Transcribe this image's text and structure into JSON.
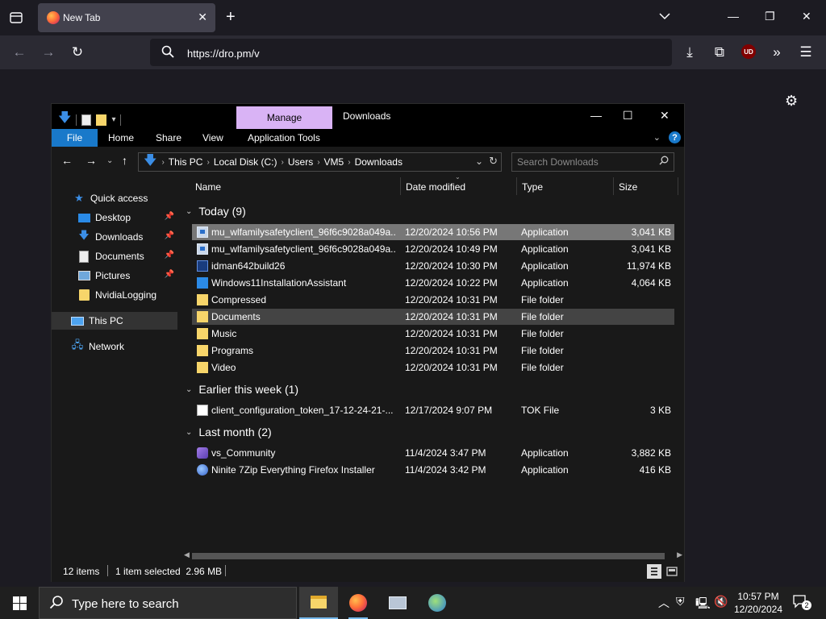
{
  "browser": {
    "tab_title": "New Tab",
    "url": "https://dro.pm/v",
    "ublock_label": "UD"
  },
  "explorer": {
    "title": "Downloads",
    "contextual_tab": "Manage",
    "ribbon_tabs": [
      "File",
      "Home",
      "Share",
      "View",
      "Application Tools"
    ],
    "breadcrumbs": [
      "This PC",
      "Local Disk (C:)",
      "Users",
      "VM5",
      "Downloads"
    ],
    "search_placeholder": "Search Downloads",
    "nav": {
      "quick_access": "Quick access",
      "desktop": "Desktop",
      "downloads": "Downloads",
      "documents": "Documents",
      "pictures": "Pictures",
      "nvidia": "NvidiaLogging",
      "this_pc": "This PC",
      "network": "Network"
    },
    "columns": {
      "name": "Name",
      "date": "Date modified",
      "type": "Type",
      "size": "Size"
    },
    "groups": {
      "today": "Today (9)",
      "week": "Earlier this week (1)",
      "month": "Last month (2)"
    },
    "rows": [
      {
        "name": "mu_wlfamilysafetyclient_96f6c9028a049a...",
        "date": "12/20/2024 10:56 PM",
        "type": "Application",
        "size": "3,041 KB"
      },
      {
        "name": "mu_wlfamilysafetyclient_96f6c9028a049a...",
        "date": "12/20/2024 10:49 PM",
        "type": "Application",
        "size": "3,041 KB"
      },
      {
        "name": "idman642build26",
        "date": "12/20/2024 10:30 PM",
        "type": "Application",
        "size": "11,974 KB"
      },
      {
        "name": "Windows11InstallationAssistant",
        "date": "12/20/2024 10:22 PM",
        "type": "Application",
        "size": "4,064 KB"
      },
      {
        "name": "Compressed",
        "date": "12/20/2024 10:31 PM",
        "type": "File folder",
        "size": ""
      },
      {
        "name": "Documents",
        "date": "12/20/2024 10:31 PM",
        "type": "File folder",
        "size": ""
      },
      {
        "name": "Music",
        "date": "12/20/2024 10:31 PM",
        "type": "File folder",
        "size": ""
      },
      {
        "name": "Programs",
        "date": "12/20/2024 10:31 PM",
        "type": "File folder",
        "size": ""
      },
      {
        "name": "Video",
        "date": "12/20/2024 10:31 PM",
        "type": "File folder",
        "size": ""
      },
      {
        "name": "client_configuration_token_17-12-24-21-...",
        "date": "12/17/2024 9:07 PM",
        "type": "TOK File",
        "size": "3 KB"
      },
      {
        "name": "vs_Community",
        "date": "11/4/2024 3:47 PM",
        "type": "Application",
        "size": "3,882 KB"
      },
      {
        "name": "Ninite 7Zip Everything Firefox Installer",
        "date": "11/4/2024 3:42 PM",
        "type": "Application",
        "size": "416 KB"
      }
    ],
    "status": {
      "items": "12 items",
      "selected": "1 item selected  2.96 MB"
    }
  },
  "taskbar": {
    "search_placeholder": "Type here to search",
    "time": "10:57 PM",
    "date": "12/20/2024",
    "notifications": "2"
  }
}
